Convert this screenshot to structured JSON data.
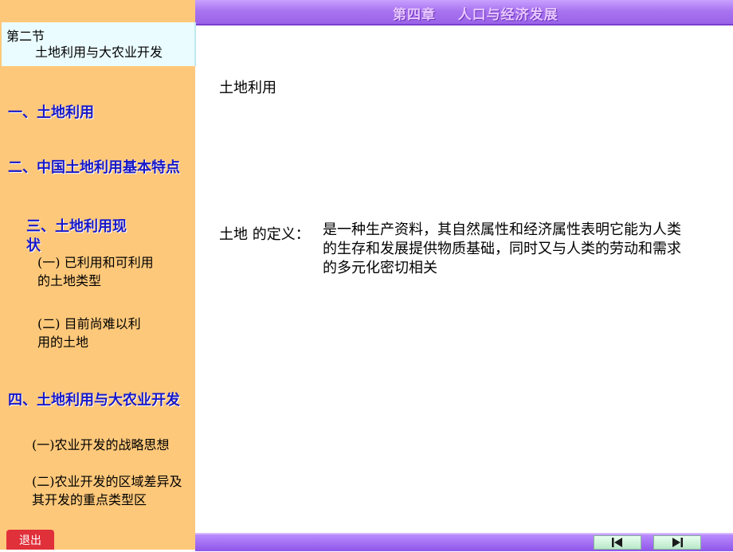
{
  "header": {
    "title": "第四章    人口与经济发展"
  },
  "sidebar": {
    "section_label": "第二节",
    "section_title": "土地利用与大农业开发",
    "items": [
      {
        "label": "一、土地利用"
      },
      {
        "label": "二、中国土地利用基本特点"
      },
      {
        "label_line1": "三、土地利用现",
        "label_line2": "状"
      },
      {
        "label_line1": "(一) 已利用和可利用",
        "label_line2": "的土地类型"
      },
      {
        "label_line1": "(二) 目前尚难以利",
        "label_line2": "用的土地"
      },
      {
        "label": "四、土地利用与大农业开发"
      },
      {
        "label": "(一)农业开发的战略思想"
      },
      {
        "label_line1": "(二)农业开发的区域差异及",
        "label_line2": "其开发的重点类型区"
      }
    ],
    "exit_label": "退出"
  },
  "main": {
    "heading": "土地利用",
    "definition_label": "土地 的定义：",
    "definition_text": "是一种生产资料，其自然属性和经济属性表明它能为人类的生存和发展提供物质基础，同时又与人类的劳动和需求的多元化密切相关"
  },
  "footer": {
    "prev_icon": "first-slide-icon",
    "next_icon": "last-slide-icon"
  },
  "colors": {
    "sidebar_bg": "#fec87a",
    "banner": "#a874f0",
    "nav_link": "#1818c8",
    "exit_button": "#e0303a"
  }
}
